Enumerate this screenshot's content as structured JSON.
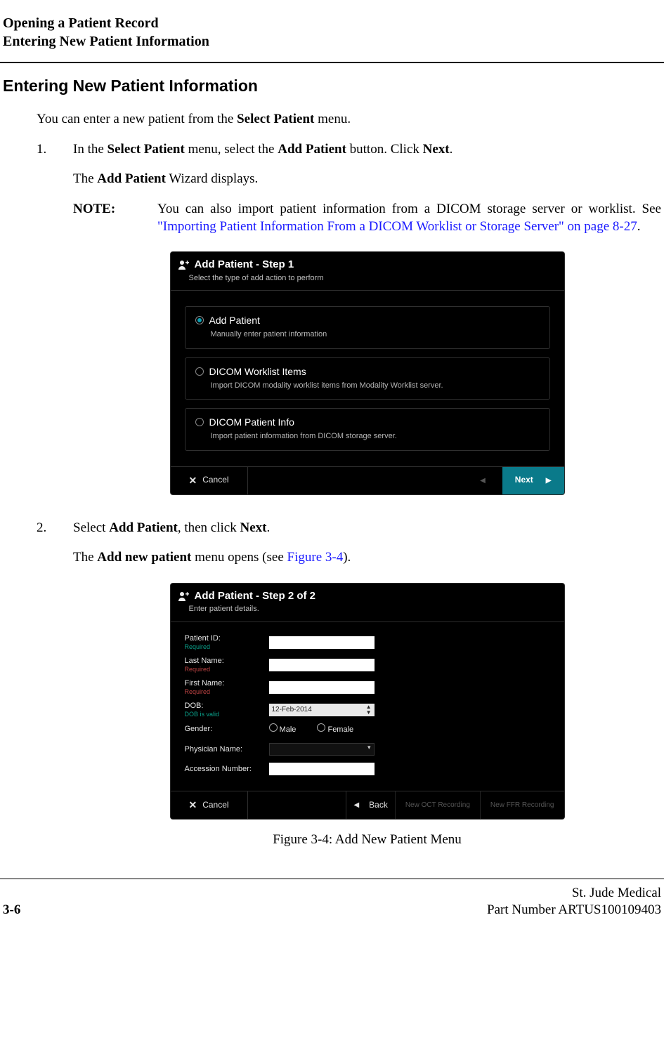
{
  "header": {
    "line1": "Opening a Patient Record",
    "line2": "Entering New Patient Information"
  },
  "section_title": "Entering New Patient Information",
  "intro_text": "You can enter a new patient from the ",
  "intro_bold": "Select Patient",
  "intro_tail": " menu.",
  "step1": {
    "num": "1.",
    "p1_a": "In the ",
    "p1_b": "Select Patient",
    "p1_c": " menu, select the ",
    "p1_d": "Add Patient",
    "p1_e": " button. Click ",
    "p1_f": "Next",
    "p1_g": ".",
    "p2_a": "The ",
    "p2_b": "Add Patient",
    "p2_c": " Wizard displays.",
    "note_label": "NOTE:",
    "note_pre": "You can also import patient information from a DICOM storage server or worklist. See ",
    "note_link": "\"Importing Patient Information From a DICOM Worklist or Storage Server\" on page 8-27",
    "note_post": "."
  },
  "dialog1": {
    "title": "Add Patient - Step 1",
    "subtitle": "Select the type of add action to perform",
    "opt1_title": "Add Patient",
    "opt1_desc": "Manually enter patient information",
    "opt2_title": "DICOM Worklist Items",
    "opt2_desc": "Import DICOM modality worklist items from Modality Worklist server.",
    "opt3_title": "DICOM Patient Info",
    "opt3_desc": "Import patient information from DICOM storage server.",
    "cancel": "Cancel",
    "next": "Next"
  },
  "step2": {
    "num": "2.",
    "p1_a": "Select ",
    "p1_b": "Add Patient",
    "p1_c": ", then click ",
    "p1_d": "Next",
    "p1_e": ".",
    "p2_a": "The ",
    "p2_b": "Add new patient",
    "p2_c": " menu opens (see ",
    "p2_link": "Figure 3-4",
    "p2_d": ")."
  },
  "dialog2": {
    "title": "Add Patient - Step 2 of 2",
    "subtitle": "Enter patient details.",
    "patient_id_label": "Patient ID:",
    "required": "Required",
    "last_name_label": "Last Name:",
    "first_name_label": "First Name:",
    "dob_label": "DOB:",
    "dob_hint": "DOB is valid",
    "dob_value": "12-Feb-2014",
    "gender_label": "Gender:",
    "male": "Male",
    "female": "Female",
    "physician_label": "Physician Name:",
    "accession_label": "Accession Number:",
    "cancel": "Cancel",
    "back": "Back",
    "grey1": "New OCT Recording",
    "grey2": "New FFR Recording"
  },
  "figure_caption": "Figure 3-4:  Add New Patient Menu",
  "footer": {
    "page_num": "3-6",
    "company": "St. Jude Medical",
    "part": "Part Number ARTUS100109403"
  }
}
